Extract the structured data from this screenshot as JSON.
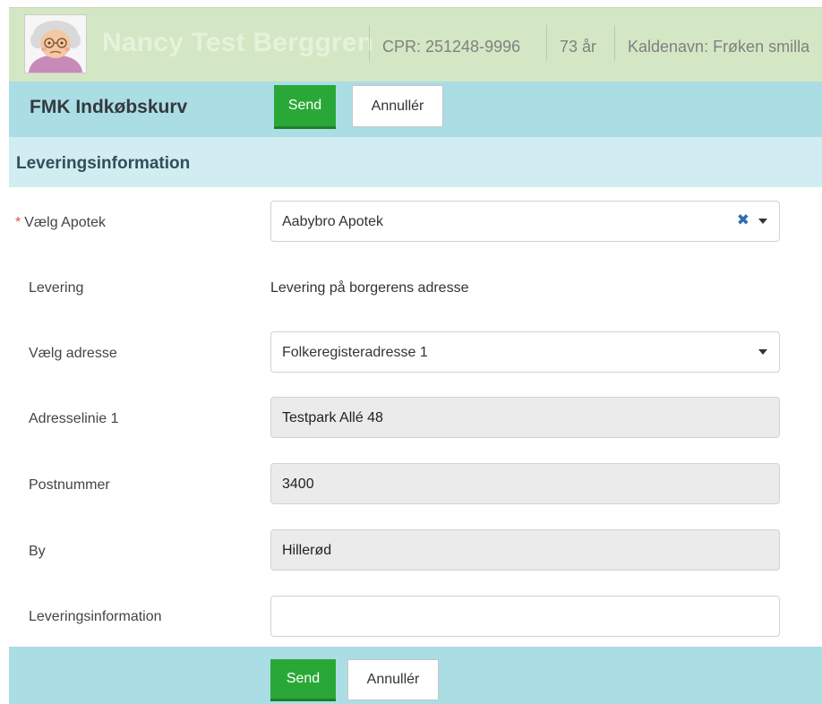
{
  "patient": {
    "name": "Nancy Test Berggren",
    "cpr": "CPR: 251248-9996",
    "age": "73 år",
    "nickname": "Kaldenavn: Frøken smilla"
  },
  "cart": {
    "title": "FMK Indkøbskurv",
    "send_label": "Send",
    "cancel_label": "Annullér"
  },
  "delivery": {
    "section_title": "Leveringsinformation",
    "pharmacy": {
      "label": "Vælg Apotek",
      "required_mark": "*",
      "value": "Aabybro Apotek",
      "clear_icon": "clear-x-icon"
    },
    "levering": {
      "label": "Levering",
      "value": "Levering på borgerens adresse"
    },
    "address_select": {
      "label": "Vælg adresse",
      "value": "Folkeregisteradresse 1"
    },
    "address_line1": {
      "label": "Adresselinie 1",
      "value": "Testpark Allé 48"
    },
    "postcode": {
      "label": "Postnummer",
      "value": "3400"
    },
    "city": {
      "label": "By",
      "value": "Hillerød"
    },
    "info": {
      "label": "Leveringsinformation",
      "value": "",
      "placeholder": ""
    }
  },
  "colors": {
    "patient_bar": "#d3e7c4",
    "action_bar": "#abdde5",
    "section_header": "#d2edf2",
    "send_button": "#2aa837",
    "required": "#d9534f",
    "clear_icon": "#2d6fb0"
  }
}
